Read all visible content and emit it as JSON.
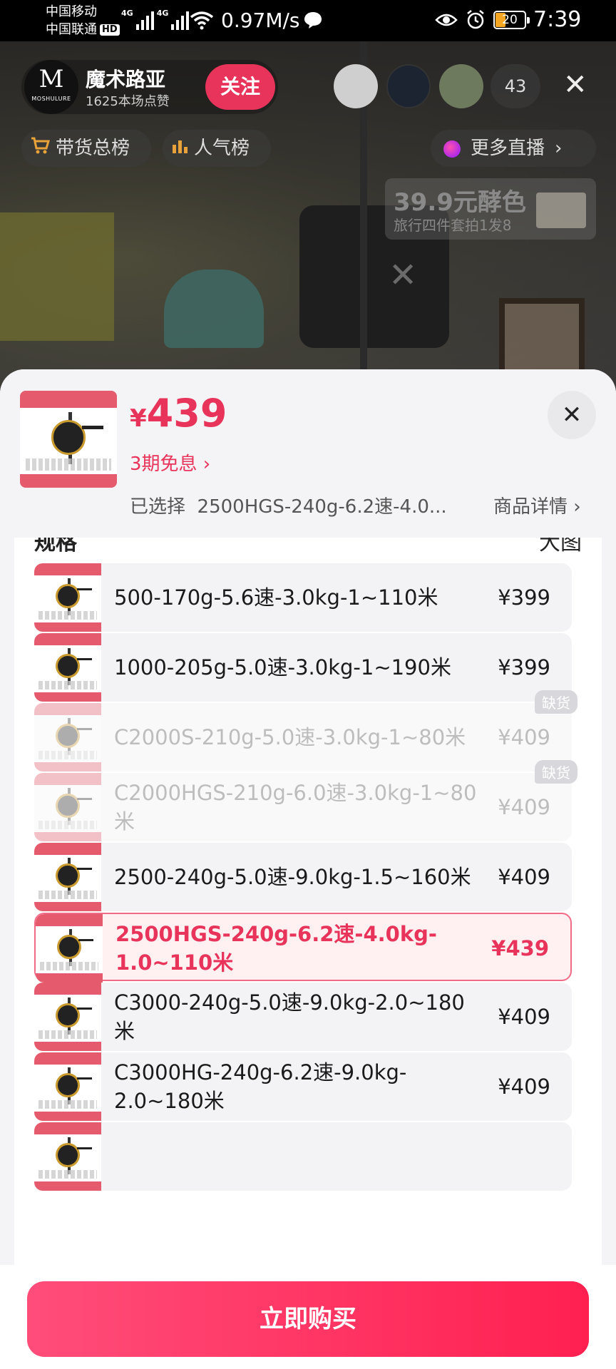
{
  "status_bar": {
    "carrier1": "中国移动",
    "carrier2": "中国联通",
    "hd": "HD",
    "signal1": "4G",
    "signal2": "4G",
    "speed": "0.97M/s",
    "battery": "20",
    "time": "7:39"
  },
  "live": {
    "anchor_name": "魔术路亚",
    "anchor_likes": "1625本场点赞",
    "avatar_text": "M",
    "avatar_sub": "MOSHULURE",
    "follow_label": "关注",
    "viewer_count": "43",
    "close_icon": "✕",
    "sales_rank": "带货总榜",
    "popularity_rank": "人气榜",
    "more_live": "更多直播",
    "promo_title": "39.9元酵色",
    "promo_sub": "旅行四件套拍1发8"
  },
  "sheet": {
    "currency": "¥",
    "price": "439",
    "installment": "3期免息",
    "selected_prefix": "已选择",
    "selected_value": "2500HGS-240g-6.2速-4.0...",
    "detail_link": "商品详情",
    "close_icon": "✕",
    "section_title": "规格",
    "section_right": "大图"
  },
  "skus": [
    {
      "name": "500-170g-5.6速-3.0kg-1~110米",
      "price": "¥399",
      "state": "normal"
    },
    {
      "name": "1000-205g-5.0速-3.0kg-1~190米",
      "price": "¥399",
      "state": "normal"
    },
    {
      "name": "C2000S-210g-5.0速-3.0kg-1~80米",
      "price": "¥409",
      "state": "out_of_stock",
      "badge": "缺货"
    },
    {
      "name": "C2000HGS-210g-6.0速-3.0kg-1~80米",
      "price": "¥409",
      "state": "out_of_stock",
      "badge": "缺货"
    },
    {
      "name": "2500-240g-5.0速-9.0kg-1.5~160米",
      "price": "¥409",
      "state": "normal"
    },
    {
      "name": "2500HGS-240g-6.2速-4.0kg-1.0~110米",
      "price": "¥439",
      "state": "selected"
    },
    {
      "name": "C3000-240g-5.0速-9.0kg-2.0~180米",
      "price": "¥409",
      "state": "normal"
    },
    {
      "name": "C3000HG-240g-6.2速-9.0kg-2.0~180米",
      "price": "¥409",
      "state": "normal"
    }
  ],
  "footer": {
    "buy_label": "立即购买"
  },
  "colors": {
    "accent": "#e8335a",
    "buy_gradient_start": "#ff4d7a",
    "buy_gradient_end": "#ff2050"
  }
}
